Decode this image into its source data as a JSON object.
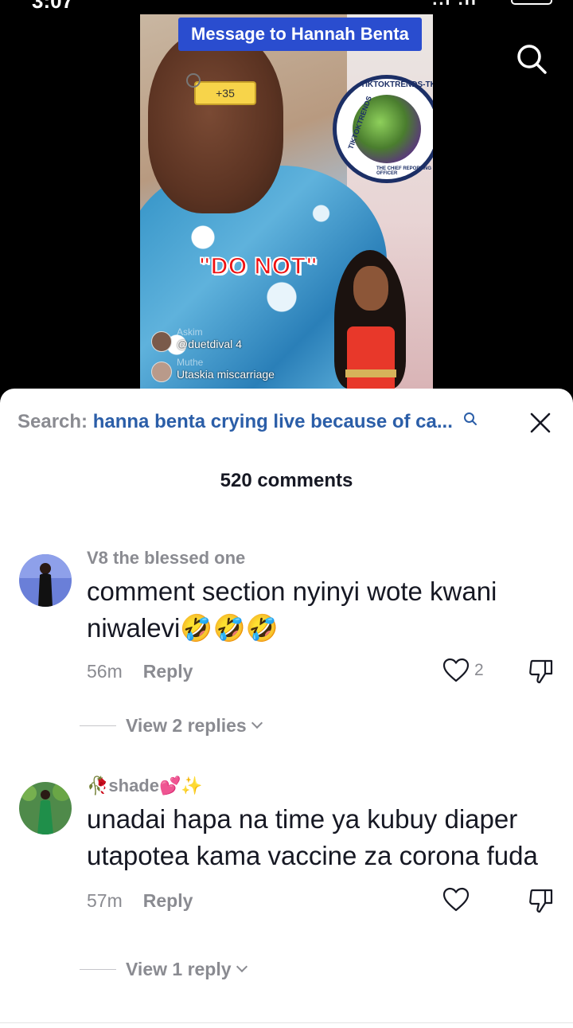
{
  "status_bar": {
    "time": "3:07",
    "signal": "..l .ıl"
  },
  "video": {
    "banner": "Message to Hannah Benta",
    "price_tag": "+35",
    "sticker_text": "\"DO NOT\"",
    "seal": {
      "top": "TIKTOKTRENDS-TK",
      "side": "TIKTOKTRENDS",
      "bottom": "THE CHIEF REPORTING OFFICER"
    },
    "overlay_comments": [
      {
        "name": "Askim",
        "text": "@duetdival 4"
      },
      {
        "name": "Muthe",
        "text": "Utaskia miscarriage"
      }
    ]
  },
  "search": {
    "label": "Search:",
    "query": "hanna benta crying live because of ca..."
  },
  "comment_count": "520 comments",
  "comments": [
    {
      "user": "V8 the blessed one",
      "text": "comment section nyinyi wote kwani niwalevi🤣🤣🤣",
      "time": "56m",
      "reply_label": "Reply",
      "likes": "2",
      "view_replies": "View 2 replies"
    },
    {
      "user": "🥀shade💕✨",
      "text": "unadai hapa na time ya kubuy diaper utapotea kama vaccine za corona fuda",
      "time": "57m",
      "reply_label": "Reply",
      "likes": "",
      "view_replies": "View 1 reply"
    }
  ],
  "colors": {
    "link_blue": "#2b5ea8",
    "muted_gray": "#8a8b91",
    "text_dark": "#161823",
    "banner_blue": "#2a4dcf"
  },
  "icons": [
    "search-icon",
    "close-icon",
    "heart-icon",
    "dislike-icon",
    "chevron-down-icon"
  ]
}
